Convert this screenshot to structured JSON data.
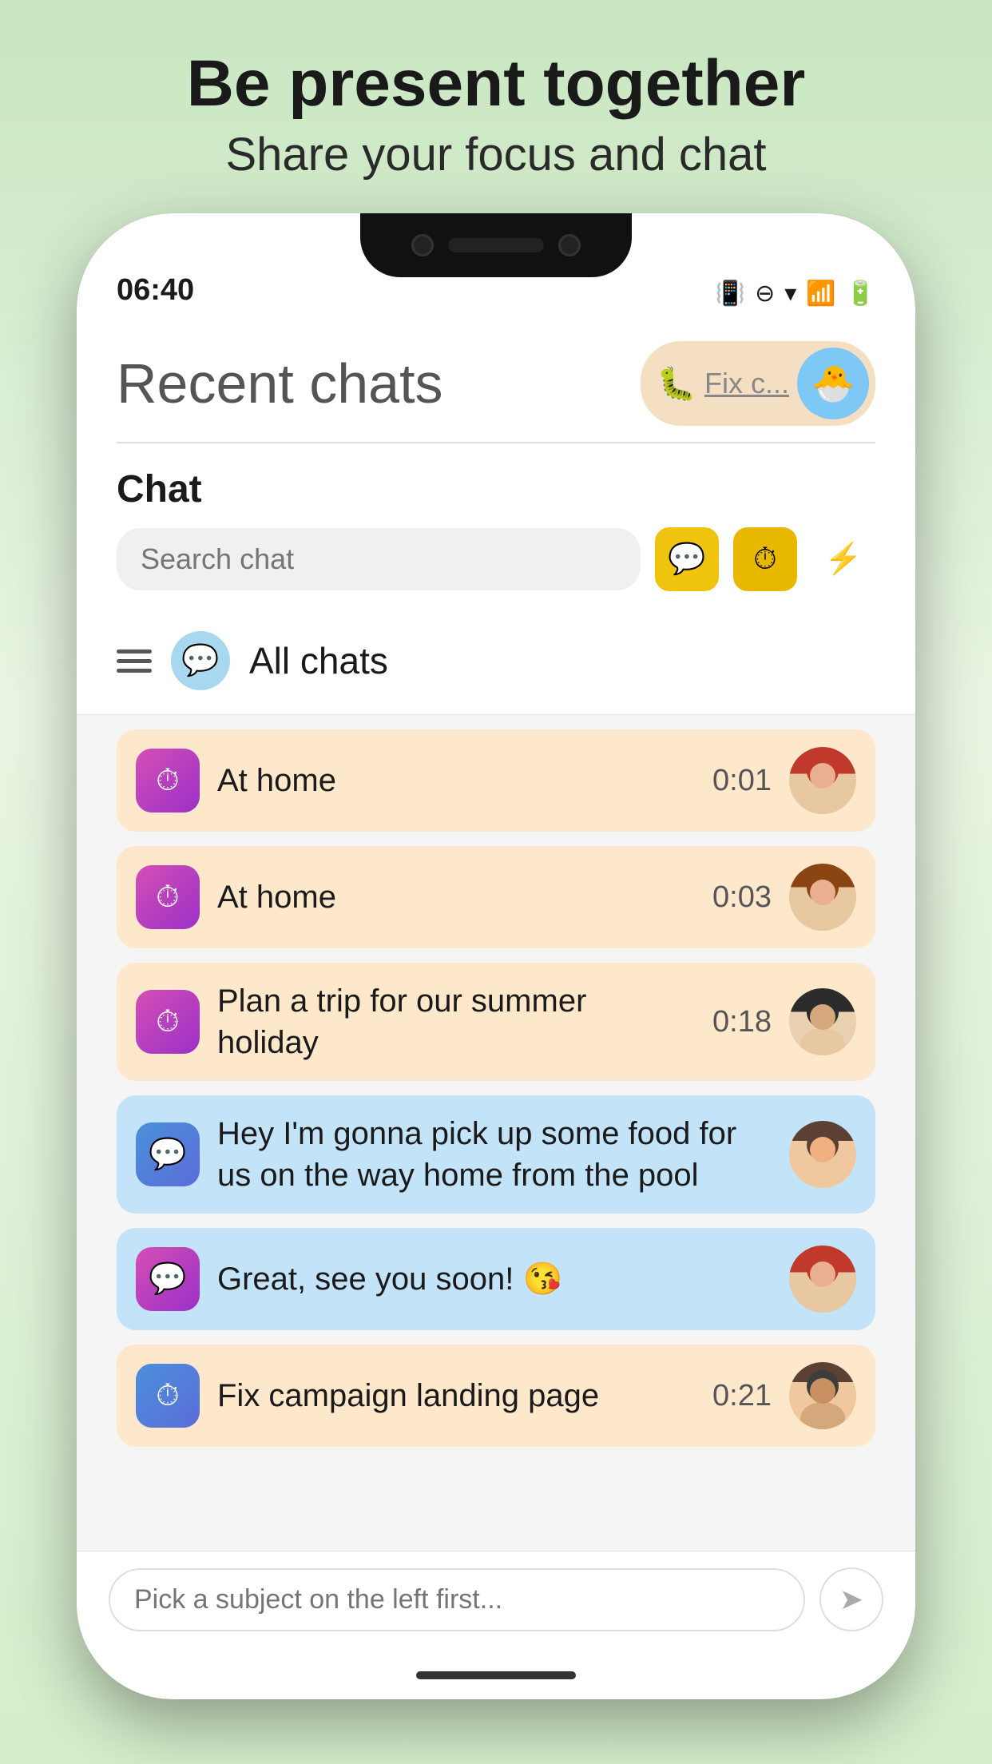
{
  "promo": {
    "title": "Be present together",
    "subtitle": "Share your focus and chat"
  },
  "status_bar": {
    "time": "06:40",
    "icons": [
      "vibrate",
      "dnd",
      "wifi",
      "signal",
      "battery"
    ]
  },
  "header": {
    "title": "Recent chats",
    "fix_label": "Fix c...",
    "avatar_emoji": "🐣"
  },
  "chat_panel": {
    "label": "Chat",
    "search_placeholder": "Search chat",
    "btn1_icon": "💬",
    "btn2_icon": "⏱",
    "btn3_icon": "⚡"
  },
  "filter_row": {
    "label": "All chats"
  },
  "chat_items": [
    {
      "id": 1,
      "name": "At home",
      "time": "0:01",
      "bg": "peach",
      "icon_type": "timer",
      "avatar_type": "1"
    },
    {
      "id": 2,
      "name": "At home",
      "time": "0:03",
      "bg": "peach",
      "icon_type": "timer",
      "avatar_type": "2"
    },
    {
      "id": 3,
      "name": "Plan a trip for our summer holiday",
      "time": "0:18",
      "bg": "peach",
      "icon_type": "timer",
      "avatar_type": "3"
    },
    {
      "id": 4,
      "name": "Hey I'm gonna pick up some food for us on the way home from the pool",
      "time": "",
      "bg": "blue",
      "icon_type": "chat",
      "avatar_type": "4"
    },
    {
      "id": 5,
      "name": "Great, see you soon! 😘",
      "time": "",
      "bg": "blue",
      "icon_type": "chat",
      "avatar_type": "1"
    },
    {
      "id": 6,
      "name": "Fix campaign landing page",
      "time": "0:21",
      "bg": "peach",
      "icon_type": "timer_blue",
      "avatar_type": "4"
    }
  ],
  "bottom_input": {
    "placeholder": "Pick a subject on the left first...",
    "send_icon": "➤"
  }
}
